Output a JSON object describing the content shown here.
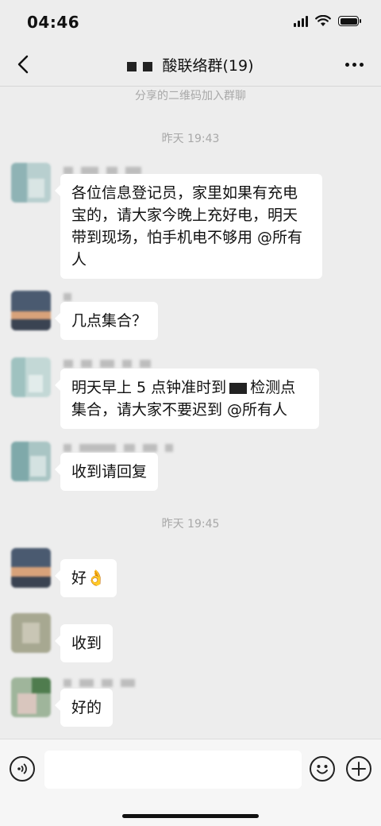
{
  "status": {
    "time": "04:46"
  },
  "nav": {
    "title": "酸联络群(19)"
  },
  "system_note": "分享的二维码加入群聊",
  "timestamps": [
    "昨天 19:43",
    "昨天 19:45"
  ],
  "messages": [
    {
      "text": "各位信息登记员，家里如果有充电宝的，请大家今晚上充好电，明天带到现场，怕手机电不够用 @所有人"
    },
    {
      "text": "几点集合？"
    },
    {
      "text_before": "明天早上 5 点钟准时到",
      "text_after": "检测点集合，请大家不要迟到 @所有人"
    },
    {
      "text": "收到请回复"
    },
    {
      "text": "好👌"
    },
    {
      "text": "收到"
    },
    {
      "text": "好的"
    }
  ],
  "input": {
    "placeholder": ""
  },
  "icons": [
    "back-arrow-icon",
    "more-dots-icon",
    "wifi-icon",
    "signal-icon",
    "battery-icon",
    "voice-icon",
    "emoji-icon",
    "plus-icon"
  ],
  "colors": {
    "background": "#ededed",
    "bubble": "#ffffff",
    "meta_text": "#a8a8a8"
  }
}
